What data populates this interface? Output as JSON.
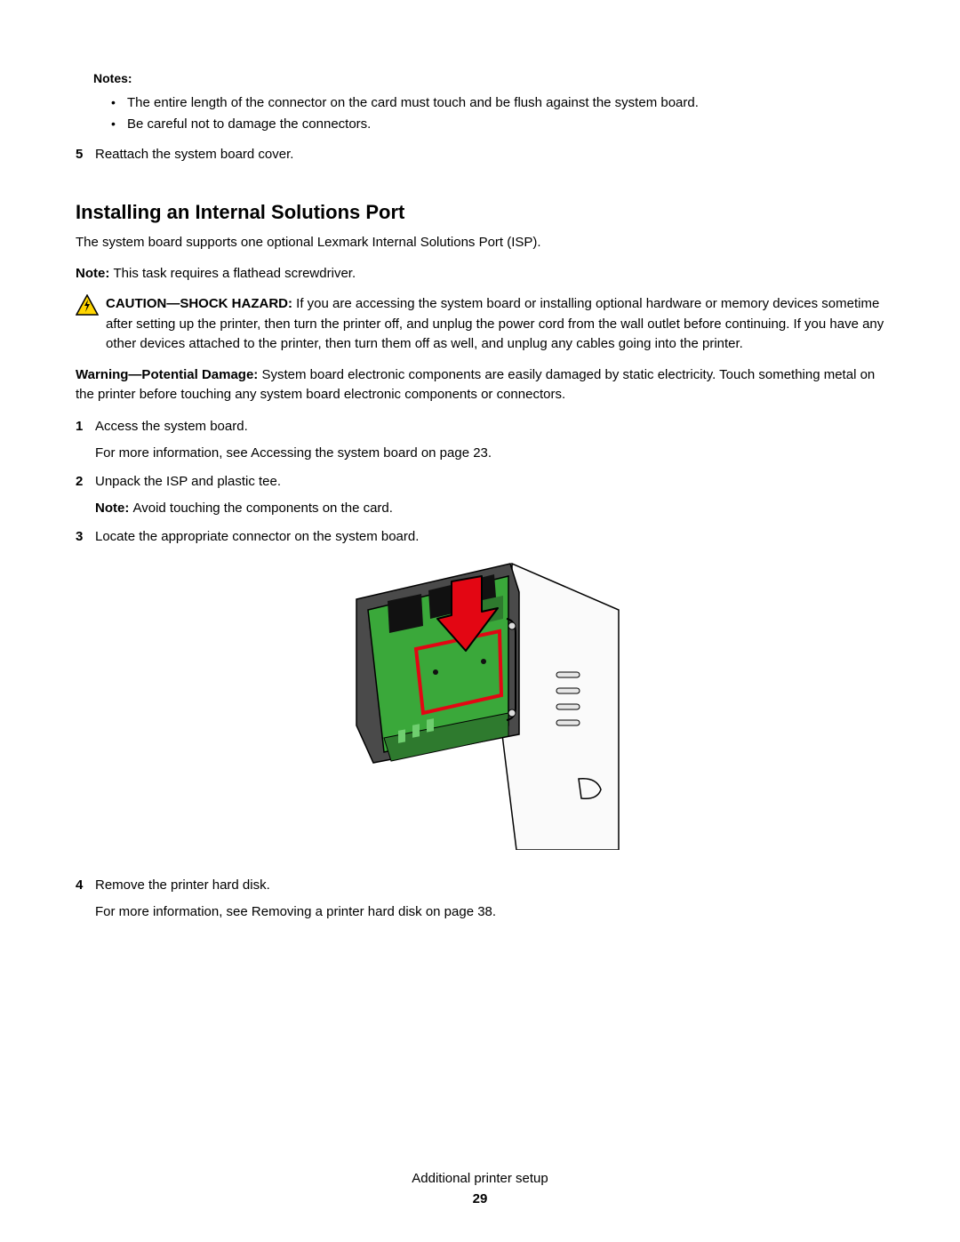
{
  "notes": {
    "heading": "Notes:",
    "items": [
      "The entire length of the connector on the card must touch and be flush against the system board.",
      "Be careful not to damage the connectors."
    ]
  },
  "step5": "Reattach the system board cover.",
  "section": {
    "heading": "Installing an Internal Solutions Port",
    "intro": "The system board supports one optional Lexmark Internal Solutions Port (ISP).",
    "note_label": "Note: ",
    "note_text": "This task requires a flathead screwdriver.",
    "caution_label": "CAUTION—SHOCK HAZARD: ",
    "caution_text": "If you are accessing the system board or installing optional hardware or memory devices sometime after setting up the printer, then turn the printer off, and unplug the power cord from the wall outlet before continuing. If you have any other devices attached to the printer, then turn them off as well, and unplug any cables going into the printer.",
    "warning_label": "Warning—Potential Damage: ",
    "warning_text": "System board electronic components are easily damaged by static electricity. Touch something metal on the printer before touching any system board electronic components or connectors.",
    "steps": {
      "s1a": "Access the system board.",
      "s1b": "For more information, see  Accessing the system board  on page 23.",
      "s2a": "Unpack the ISP and plastic tee.",
      "s2_note_label": "Note: ",
      "s2_note_text": "Avoid touching the components on the card.",
      "s3": "Locate the appropriate connector on the system board.",
      "s4a": "Remove the printer hard disk.",
      "s4b": "For more information, see  Removing a printer hard disk  on page 38."
    }
  },
  "footer": {
    "section_name": "Additional printer setup",
    "page_number": "29"
  }
}
